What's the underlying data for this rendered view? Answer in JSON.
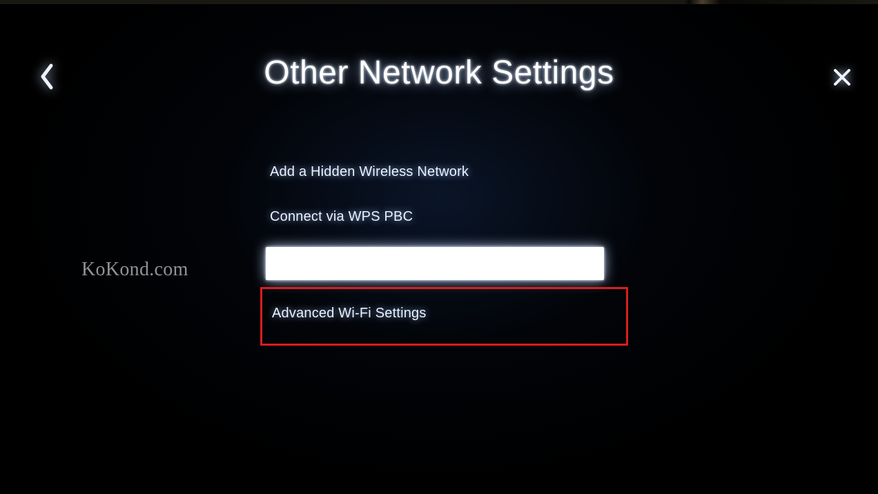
{
  "header": {
    "title": "Other Network Settings"
  },
  "menu": {
    "items": [
      {
        "label": "Add a Hidden Wireless Network"
      },
      {
        "label": "Connect via WPS PBC"
      },
      {
        "label": ""
      },
      {
        "label": "Advanced Wi-Fi Settings"
      }
    ]
  },
  "watermark": "KoKond.com"
}
